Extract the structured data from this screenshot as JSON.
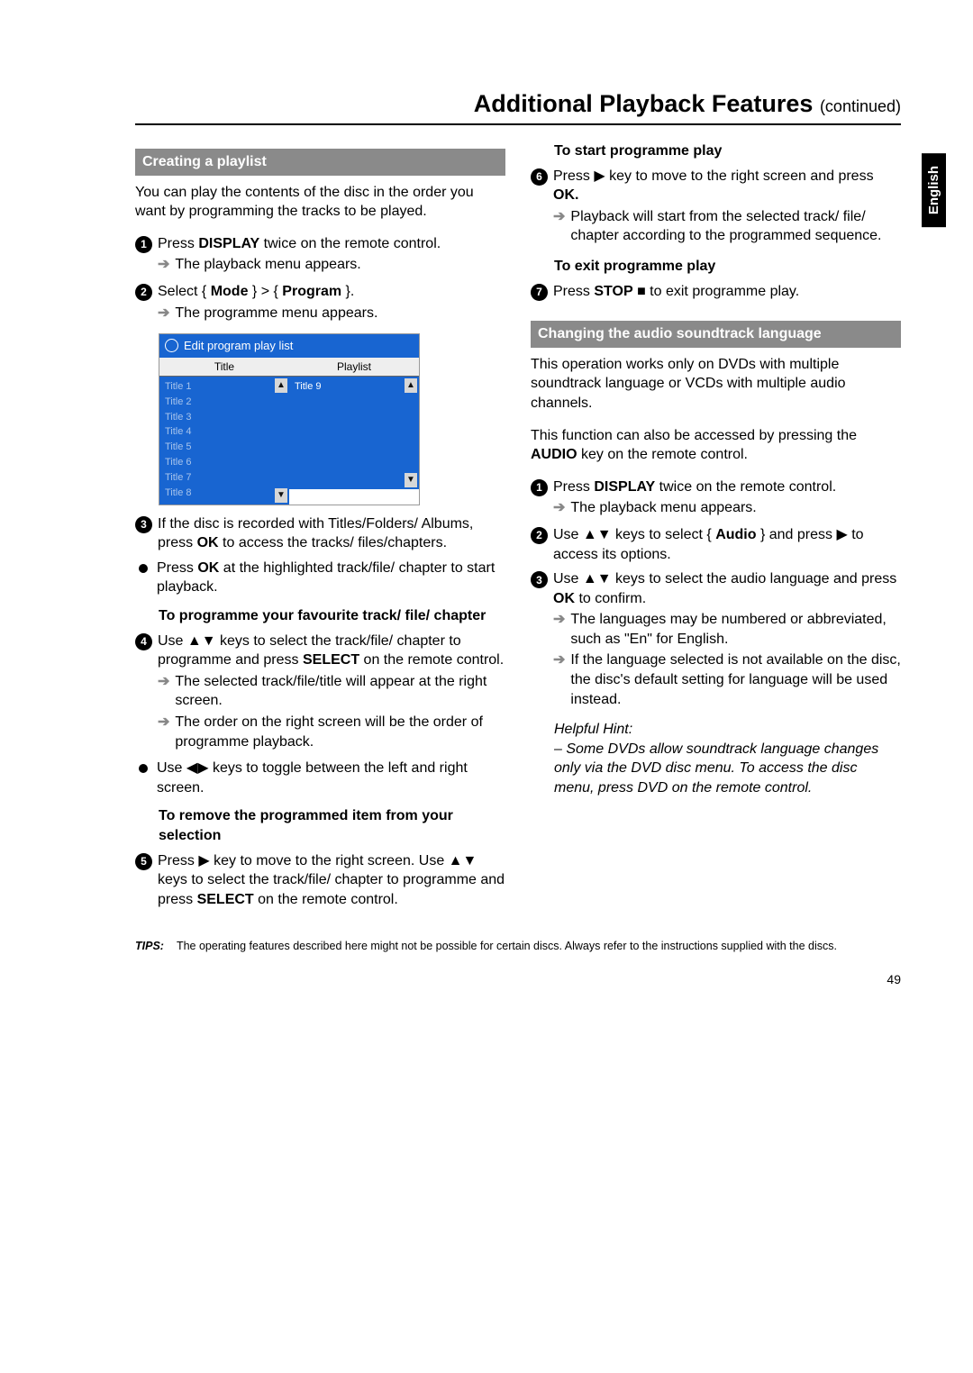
{
  "page": {
    "title": "Additional Playback Features",
    "title_cont": "(continued)",
    "language_tab": "English",
    "number": "49"
  },
  "left": {
    "sec1_title": "Creating a playlist",
    "intro": "You can play the contents of the disc in the order you want by programming the tracks to be played.",
    "step1": {
      "n": "1",
      "body_a": "Press ",
      "bold": "DISPLAY",
      "body_b": " twice on the remote control."
    },
    "step1_res": "The playback menu appears.",
    "step2": {
      "n": "2",
      "body_a": "Select { ",
      "bold_a": "Mode",
      "body_b": " } > { ",
      "bold_b": "Program",
      "body_c": " }."
    },
    "step2_res": "The programme menu appears.",
    "figure": {
      "title": "Edit program play list",
      "col_a_head": "Title",
      "col_b_head": "Playlist",
      "titles": [
        "Title 1",
        "Title 2",
        "Title 3",
        "Title 4",
        "Title 5",
        "Title 6",
        "Title 7",
        "Title 8"
      ],
      "playlist": [
        "Title 9"
      ]
    },
    "step3": {
      "n": "3",
      "body_a": "If the disc is recorded with Titles/Folders/ Albums, press ",
      "bold": "OK",
      "body_b": " to access the tracks/ files/chapters."
    },
    "bullet_a": {
      "body_a": "Press ",
      "bold": "OK",
      "body_b": " at the highlighted track/file/ chapter to start playback."
    },
    "sub_a": "To programme your favourite track/ file/ chapter",
    "step4": {
      "n": "4",
      "body_a": "Use ▲▼ keys to select the track/file/ chapter to programme and press ",
      "bold": "SELECT",
      "body_b": " on the remote control."
    },
    "step4_res1": "The selected track/file/title will appear at the right screen.",
    "step4_res2": "The order on the right screen will be the order of programme playback.",
    "bullet_b": "Use ◀▶ keys to toggle between the left and right screen.",
    "sub_b": "To remove the programmed item from your selection",
    "step5": {
      "n": "5",
      "body_a": "Press ▶ key to move to the right screen. Use ▲▼ keys to select the track/file/ chapter to programme and press ",
      "bold": "SELECT",
      "body_b": " on the remote control."
    }
  },
  "right": {
    "sub_a": "To start programme play",
    "step6": {
      "n": "6",
      "body_a": "Press ▶ key to move to the right screen and press ",
      "bold": "OK."
    },
    "step6_res": "Playback will start from the selected track/ file/ chapter according to the programmed sequence.",
    "sub_b": "To exit programme play",
    "step7": {
      "n": "7",
      "body_a": "Press ",
      "bold": "STOP",
      "body_b": " ■ to exit programme play."
    },
    "sec2_title": "Changing the audio soundtrack language",
    "para_a": "This operation works only on DVDs with multiple soundtrack language or VCDs with multiple audio channels.",
    "para_b_a": "This function can also be accessed by pressing the ",
    "para_b_bold": "AUDIO",
    "para_b_b": " key on the remote control.",
    "step1": {
      "n": "1",
      "body_a": "Press ",
      "bold": "DISPLAY",
      "body_b": " twice on the remote control."
    },
    "step1_res": "The playback menu appears.",
    "step2": {
      "n": "2",
      "body_a": "Use ▲▼ keys to select { ",
      "bold": "Audio",
      "body_b": " } and press ▶ to access its options."
    },
    "step3": {
      "n": "3",
      "body_a": "Use ▲▼ keys to select the audio language and press ",
      "bold": "OK",
      "body_b": " to confirm."
    },
    "step3_res1": "The languages may be numbered or abbreviated, such as \"En\" for English.",
    "step3_res2": "If the language selected is not available on the disc, the disc's default setting for language will be used instead.",
    "hint_head": "Helpful Hint:",
    "hint_body": "– Some DVDs allow soundtrack language changes only via the DVD disc menu. To access the disc menu, press DVD on the remote control."
  },
  "tips": {
    "label": "TIPS:",
    "body": "The operating features described here might not be possible for certain discs. Always refer to the instructions supplied with the discs."
  }
}
